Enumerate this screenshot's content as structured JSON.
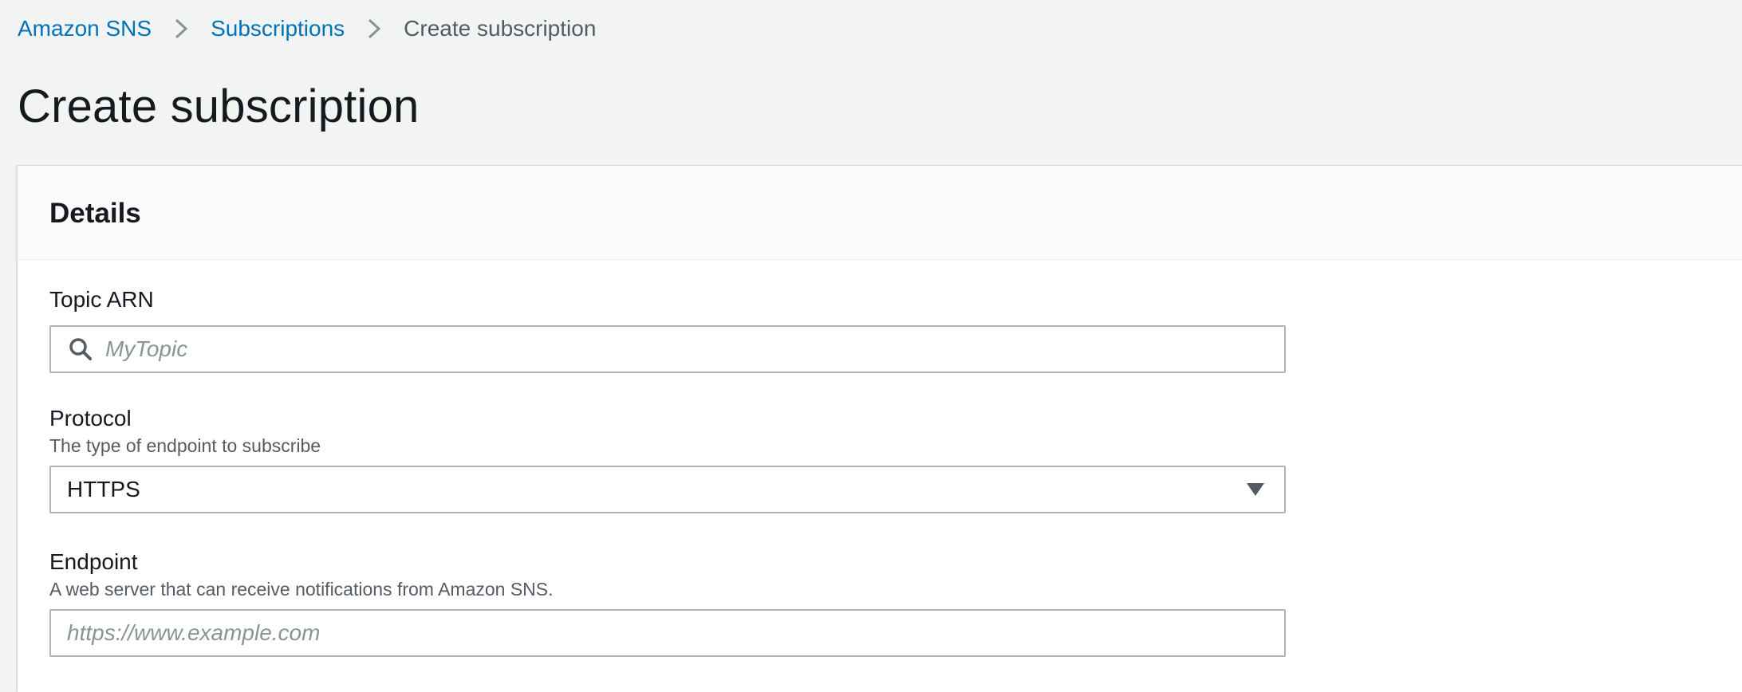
{
  "breadcrumb": {
    "items": [
      {
        "label": "Amazon SNS"
      },
      {
        "label": "Subscriptions"
      },
      {
        "label": "Create subscription"
      }
    ]
  },
  "page": {
    "title": "Create subscription"
  },
  "details": {
    "title": "Details",
    "topic_arn": {
      "label": "Topic ARN",
      "placeholder": "MyTopic",
      "value": ""
    },
    "protocol": {
      "label": "Protocol",
      "description": "The type of endpoint to subscribe",
      "selected": "HTTPS"
    },
    "endpoint": {
      "label": "Endpoint",
      "description": "A web server that can receive notifications from Amazon SNS.",
      "placeholder": "https://www.example.com",
      "value": ""
    }
  },
  "icons": {
    "search": "search-icon",
    "separator": "chevron-right-icon",
    "dropdown": "caret-down-icon"
  },
  "colors": {
    "link": "#0073bb",
    "background": "#f2f3f3",
    "panel_header": "#fafafa",
    "input_border": "#aab7b8"
  }
}
